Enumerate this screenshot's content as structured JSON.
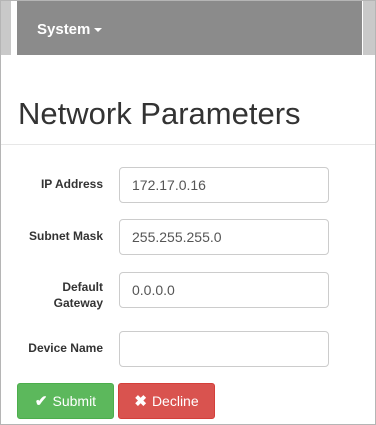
{
  "navbar": {
    "menu_label": "System"
  },
  "page": {
    "title": "Network Parameters"
  },
  "form": {
    "ip_address": {
      "label": "IP Address",
      "value": "172.17.0.16"
    },
    "subnet_mask": {
      "label": "Subnet Mask",
      "value": "255.255.255.0"
    },
    "default_gateway": {
      "label_line1": "Default",
      "label_line2": "Gateway",
      "value": "0.0.0.0"
    },
    "device_name": {
      "label": "Device Name",
      "value": ""
    }
  },
  "actions": {
    "submit": {
      "label": "Submit",
      "icon": "check-icon",
      "color": "#5cb85c"
    },
    "decline": {
      "label": "Decline",
      "icon": "close-icon",
      "color": "#d9534f"
    }
  }
}
